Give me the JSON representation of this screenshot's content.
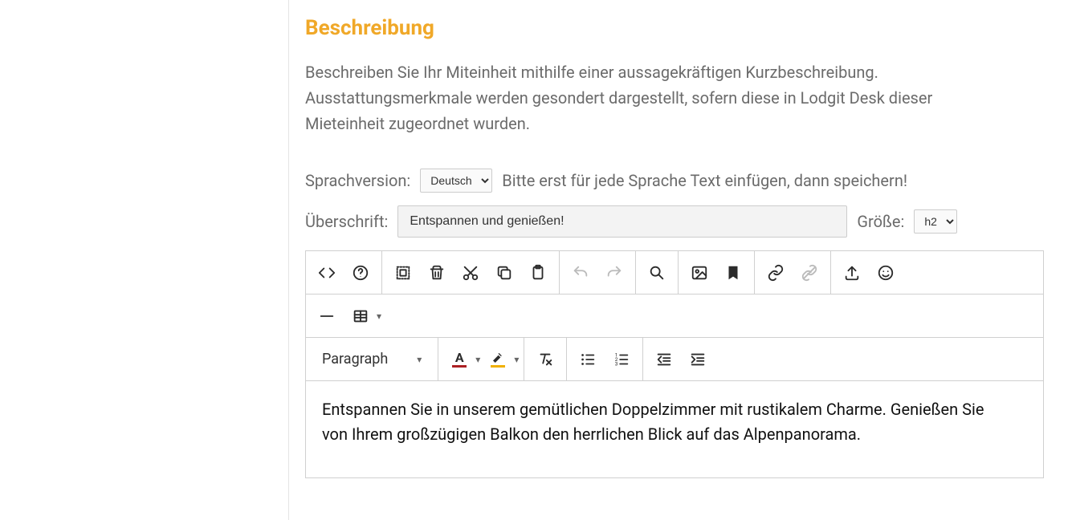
{
  "section": {
    "title": "Beschreibung",
    "description": "Beschreiben Sie Ihr Miteinheit mithilfe einer aussagekräftigen Kurzbeschreibung. Ausstattungsmerkmale werden gesondert dargestellt, sofern diese in Lodgit Desk dieser Mieteinheit zugeordnet wurden."
  },
  "language": {
    "label": "Sprachversion:",
    "selected": "Deutsch",
    "hint": "Bitte erst für jede Sprache Text einfügen, dann speichern!"
  },
  "heading": {
    "label": "Überschrift:",
    "value": "Entspannen und genießen!",
    "sizeLabel": "Größe:",
    "sizeSelected": "h2"
  },
  "toolbar": {
    "paragraph": "Paragraph"
  },
  "content": "Entspannen Sie in unserem gemütlichen Doppelzimmer mit rustikalem Charme. Genießen Sie von Ihrem großzügigen Balkon den herrlichen Blick auf das Alpenpanorama."
}
